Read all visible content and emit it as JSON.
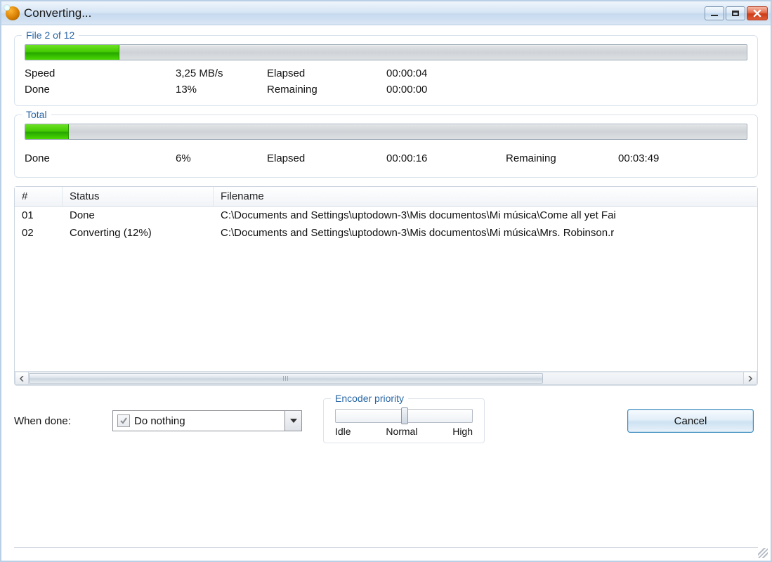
{
  "window": {
    "title": "Converting..."
  },
  "file": {
    "legend": "File 2 of 12",
    "progress_percent": 13,
    "speed_label": "Speed",
    "speed_value": "3,25 MB/s",
    "done_label": "Done",
    "done_value": "13%",
    "elapsed_label": "Elapsed",
    "elapsed_value": "00:00:04",
    "remaining_label": "Remaining",
    "remaining_value": "00:00:00"
  },
  "total": {
    "legend": "Total",
    "progress_percent": 6,
    "done_label": "Done",
    "done_value": "6%",
    "elapsed_label": "Elapsed",
    "elapsed_value": "00:00:16",
    "remaining_label": "Remaining",
    "remaining_value": "00:03:49"
  },
  "list": {
    "headers": {
      "num": "#",
      "status": "Status",
      "filename": "Filename"
    },
    "rows": [
      {
        "num": "01",
        "status": "Done",
        "filename": "C:\\Documents and Settings\\uptodown-3\\Mis documentos\\Mi música\\Come all yet Fai"
      },
      {
        "num": "02",
        "status": "Converting (12%)",
        "filename": "C:\\Documents and Settings\\uptodown-3\\Mis documentos\\Mi música\\Mrs. Robinson.r"
      }
    ]
  },
  "footer": {
    "when_done_label": "When done:",
    "when_done_value": "Do nothing",
    "priority_legend": "Encoder priority",
    "priority_labels": {
      "idle": "Idle",
      "normal": "Normal",
      "high": "High"
    },
    "cancel_label": "Cancel"
  }
}
